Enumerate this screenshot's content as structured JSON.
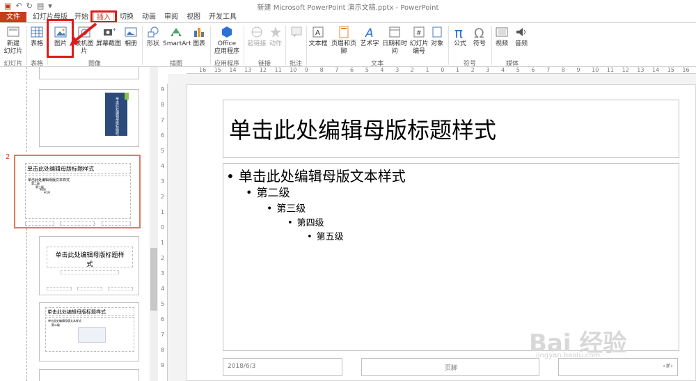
{
  "window": {
    "title": "新建 Microsoft PowerPoint 演示文稿.pptx - PowerPoint"
  },
  "tabs": [
    "文件",
    "幻灯片母版",
    "开始",
    "插入",
    "切换",
    "动画",
    "审阅",
    "视图",
    "开发工具"
  ],
  "active_tab": "插入",
  "ribbon": {
    "buttons": [
      {
        "label": "新建",
        "sub": "幻灯片",
        "icon": "new-slide-icon"
      },
      {
        "label": "表格",
        "icon": "table-icon"
      },
      {
        "label": "图片",
        "icon": "picture-icon"
      },
      {
        "label": "联机图片",
        "icon": "online-picture-icon"
      },
      {
        "label": "屏幕截图",
        "icon": "screenshot-icon"
      },
      {
        "label": "相册",
        "icon": "photo-album-icon"
      },
      {
        "label": "形状",
        "icon": "shapes-icon"
      },
      {
        "label": "SmartArt",
        "icon": "smartart-icon"
      },
      {
        "label": "图表",
        "icon": "chart-icon"
      },
      {
        "label": "Office",
        "sub": "应用程序",
        "icon": "office-apps-icon"
      },
      {
        "label": "超链接",
        "icon": "hyperlink-icon"
      },
      {
        "label": "动作",
        "icon": "action-icon"
      },
      {
        "label": "批注",
        "icon": "comment-icon"
      },
      {
        "label": "文本框",
        "icon": "textbox-icon"
      },
      {
        "label": "页眉和页脚",
        "icon": "header-footer-icon"
      },
      {
        "label": "艺术字",
        "icon": "wordart-icon"
      },
      {
        "label": "日期和时间",
        "icon": "datetime-icon"
      },
      {
        "label": "幻灯片",
        "sub": "编号",
        "icon": "slide-number-icon"
      },
      {
        "label": "对象",
        "icon": "object-icon"
      },
      {
        "label": "公式",
        "icon": "equation-icon"
      },
      {
        "label": "符号",
        "icon": "symbol-icon"
      },
      {
        "label": "视频",
        "icon": "video-icon"
      },
      {
        "label": "音频",
        "icon": "audio-icon"
      }
    ],
    "groups": [
      "幻灯片",
      "表格",
      "图像",
      "插图",
      "应用程序",
      "链接",
      "批注",
      "文本",
      "符号",
      "媒体"
    ]
  },
  "ruler": {
    "h_labels": [
      "16",
      "15",
      "14",
      "13",
      "12",
      "11",
      "10",
      "9",
      "8",
      "7",
      "6",
      "5",
      "4",
      "3",
      "2",
      "1",
      "0",
      "1",
      "2",
      "3",
      "4",
      "5",
      "6",
      "7",
      "8",
      "9",
      "10",
      "11",
      "12",
      "13",
      "14",
      "15",
      "16"
    ],
    "v_labels": [
      "9",
      "8",
      "7",
      "6",
      "5",
      "4",
      "3",
      "2",
      "1",
      "0",
      "1",
      "2",
      "3",
      "4",
      "5",
      "6",
      "7",
      "8",
      "9"
    ]
  },
  "thumbnails": {
    "selected_number": "2",
    "t3_title": "单击此处编辑母版标题样",
    "t3_title2": "式",
    "t4_title": "单击此处编辑母版标题样式",
    "t2_title": "单击此处编辑母版标题样式",
    "t2_body": "单击此处编辑母版文本样式",
    "t2_l2": "第二级",
    "t2_l3": "第三级",
    "t2_l4": "第四级",
    "t2_l5": "第五级",
    "t4_body": "单击此处编辑母版文本样式",
    "t4_l2": "第二级",
    "t1_vertical": "单击此处编辑母版标题样式"
  },
  "slide": {
    "title": "单击此处编辑母版标题样式",
    "body": [
      "单击此处编辑母版文本样式",
      "第二级",
      "第三级",
      "第四级",
      "第五级"
    ],
    "date": "2018/6/3",
    "footer": "页脚",
    "number": "‹#›"
  },
  "watermark": {
    "main": "Bai 经验",
    "sub": "jingyan.baidu.com"
  },
  "colors": {
    "accent": "#c43e1c",
    "highlight": "#e01a1a"
  }
}
